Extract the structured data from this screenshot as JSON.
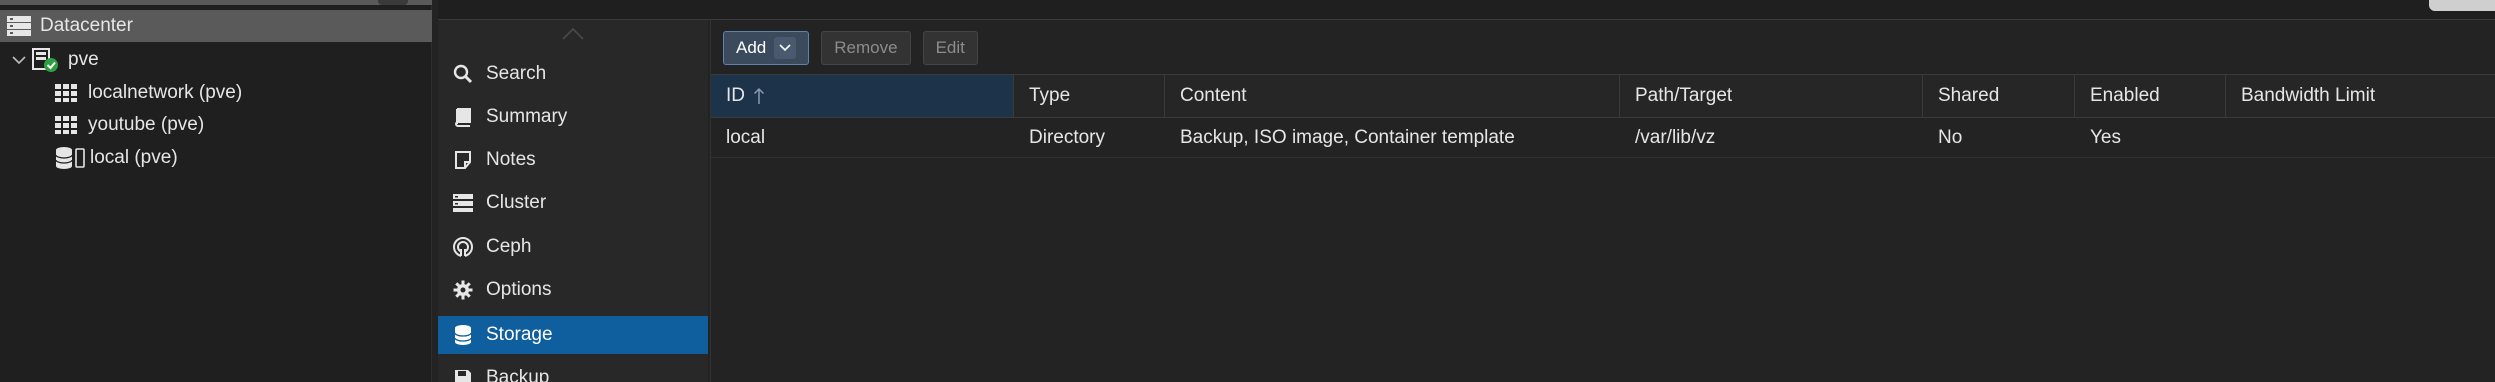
{
  "tree": {
    "datacenter": "Datacenter",
    "node": "pve",
    "items": [
      {
        "label": "localnetwork (pve)",
        "icon": "grid-icon"
      },
      {
        "label": "youtube (pve)",
        "icon": "grid-icon"
      },
      {
        "label": "local (pve)",
        "icon": "storage-icon"
      }
    ]
  },
  "nav": {
    "items": [
      {
        "label": "Search",
        "icon": "search-icon"
      },
      {
        "label": "Summary",
        "icon": "book-icon"
      },
      {
        "label": "Notes",
        "icon": "notes-icon"
      },
      {
        "label": "Cluster",
        "icon": "cluster-icon"
      },
      {
        "label": "Ceph",
        "icon": "ceph-icon"
      },
      {
        "label": "Options",
        "icon": "gear-icon"
      },
      {
        "label": "Storage",
        "icon": "database-icon",
        "active": true
      },
      {
        "label": "Backup",
        "icon": "floppy-icon"
      }
    ]
  },
  "toolbar": {
    "add_label": "Add",
    "remove_label": "Remove",
    "edit_label": "Edit"
  },
  "table": {
    "columns": [
      "ID",
      "Type",
      "Content",
      "Path/Target",
      "Shared",
      "Enabled",
      "Bandwidth Limit"
    ],
    "sorted_column": "ID",
    "rows": [
      [
        "local",
        "Directory",
        "Backup, ISO image, Container template",
        "/var/lib/vz",
        "No",
        "Yes",
        ""
      ]
    ]
  },
  "colors": {
    "accent": "#0f5e9e",
    "selected_tree": "#5a5a5a",
    "status_ok": "#2ea043"
  }
}
